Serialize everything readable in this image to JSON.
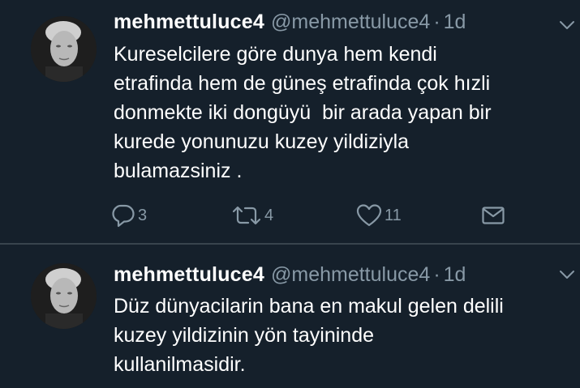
{
  "tweets": [
    {
      "display_name": "mehmettuluce4",
      "handle": "@mehmettuluce4",
      "separator": "·",
      "time": "1d",
      "text": "Kureselcilere göre dunya hem kendi\netrafinda hem de güneş etrafinda çok hızli\ndonmekte iki dongüyü  bir arada yapan bir\nkurede yonunuzu kuzey yildiziyla\nbulamazsiniz .",
      "reply_count": "3",
      "retweet_count": "4",
      "like_count": "11"
    },
    {
      "display_name": "mehmettuluce4",
      "handle": "@mehmettuluce4",
      "separator": "·",
      "time": "1d",
      "text": "Düz dünyacilarin bana en makul gelen delili\nkuzey yildizinin yön tayininde\nkullanilmasidir."
    }
  ],
  "icons": {
    "reply": "reply-icon",
    "retweet": "retweet-icon",
    "like": "heart-icon",
    "dm": "envelope-icon",
    "caret": "chevron-down-icon",
    "avatar": "avatar"
  },
  "colors": {
    "background": "#15202b",
    "text": "#ffffff",
    "secondary": "#8899a6",
    "divider": "#38444d"
  }
}
